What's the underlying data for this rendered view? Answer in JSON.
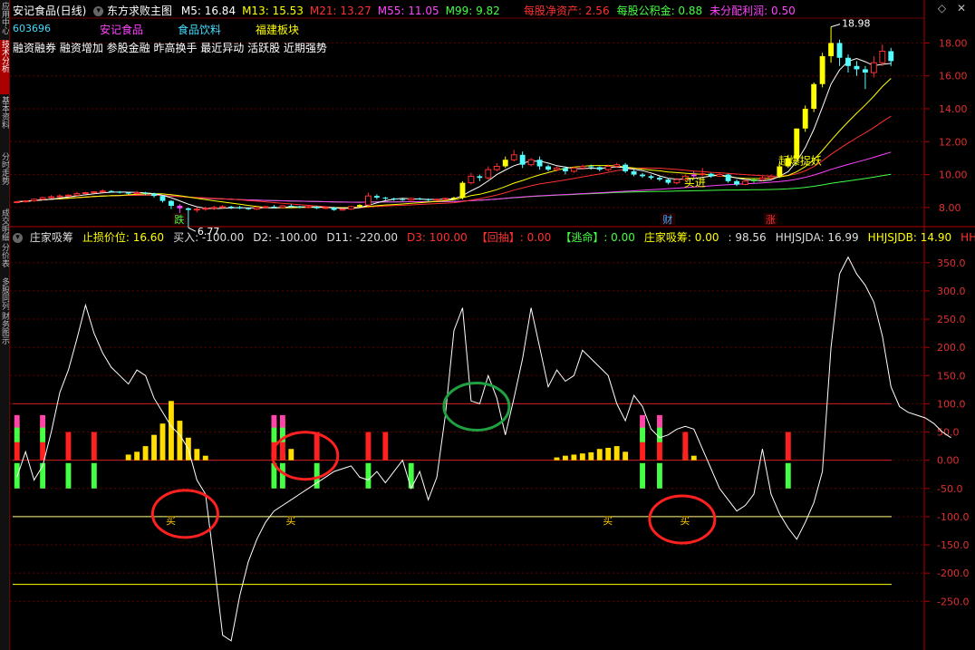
{
  "side_tabs": [
    "应用中心",
    "技术分析",
    "基本资料",
    "分时走势",
    "成交明细",
    "分价表",
    "多股同列",
    "财务图示"
  ],
  "header": {
    "stock_title": "安记食品(日线)",
    "template": "东方求败主图",
    "ma": [
      {
        "label": "M5: 16.84",
        "color": "#ffffff"
      },
      {
        "label": "M13: 15.53",
        "color": "#ffff00"
      },
      {
        "label": "M21: 13.27",
        "color": "#ff3030"
      },
      {
        "label": "M55: 11.05",
        "color": "#ff44ff"
      },
      {
        "label": "M99: 9.82",
        "color": "#44ff44"
      }
    ],
    "fundamentals": [
      {
        "label": "每股净资产: 2.56",
        "color": "#ff3030"
      },
      {
        "label": "每股公积金: 0.88",
        "color": "#44ff44"
      },
      {
        "label": "未分配利润: 0.50",
        "color": "#ff44ff"
      }
    ]
  },
  "concepts": "融资融券 融资增加 参股金融 昨高换手 最近异动 活跃股 近期强势",
  "stock_code": "603696",
  "badges": [
    {
      "text": "安记食品",
      "color": "#ff44ff"
    },
    {
      "text": "食品饮料",
      "color": "#44ddff"
    },
    {
      "text": "福建板块",
      "color": "#ffff00"
    }
  ],
  "indicator_header": [
    {
      "text": "庄家吸筹",
      "color": "#dddddd"
    },
    {
      "text": "止损价位: 16.60",
      "color": "#ffff00"
    },
    {
      "text": "买入: -100.00",
      "color": "#dddddd"
    },
    {
      "text": "D2: -100.00",
      "color": "#dddddd"
    },
    {
      "text": "D11: -220.00",
      "color": "#dddddd"
    },
    {
      "text": "D3: 100.00",
      "color": "#ff3030"
    },
    {
      "text": "【回抽】: 0.00",
      "color": "#ff3030"
    },
    {
      "text": "【逃命】: 0.00",
      "color": "#44ff44"
    },
    {
      "text": "庄家吸筹: 0.00",
      "color": "#ffff00"
    },
    {
      "text": ": 98.56",
      "color": "#dddddd"
    },
    {
      "text": "HHJSJDA: 16.99",
      "color": "#dddddd"
    },
    {
      "text": "HHJSJDB: 14.90",
      "color": "#ffff00"
    },
    {
      "text": "HHJS",
      "color": "#ff3030"
    }
  ],
  "chart_data": {
    "type": "candlestick",
    "price": {
      "ylim": [
        7.0,
        19.4
      ],
      "y_ticks": [
        "8.00",
        "10.00",
        "12.00",
        "14.00",
        "16.00",
        "18.00"
      ],
      "y_tick_values": [
        8,
        10,
        12,
        14,
        16,
        18
      ],
      "candles": [
        [
          8.3,
          8.35,
          8.4,
          8.25
        ],
        [
          8.35,
          8.4,
          8.45,
          8.3
        ],
        [
          8.4,
          8.5,
          8.55,
          8.35
        ],
        [
          8.5,
          8.6,
          8.65,
          8.45
        ],
        [
          8.6,
          8.65,
          8.75,
          8.55
        ],
        [
          8.65,
          8.7,
          8.8,
          8.6
        ],
        [
          8.7,
          8.75,
          8.8,
          8.65
        ],
        [
          8.75,
          8.85,
          8.95,
          8.7
        ],
        [
          8.85,
          8.9,
          8.95,
          8.8
        ],
        [
          8.9,
          8.95,
          9.0,
          8.85
        ],
        [
          8.95,
          9.0,
          9.1,
          8.9
        ],
        [
          9.0,
          8.95,
          9.05,
          8.9
        ],
        [
          8.95,
          8.9,
          9.0,
          8.85
        ],
        [
          8.9,
          8.85,
          8.95,
          8.8
        ],
        [
          8.85,
          8.9,
          9.0,
          8.8
        ],
        [
          8.9,
          8.85,
          8.95,
          8.75
        ],
        [
          8.85,
          8.7,
          8.9,
          8.6
        ],
        [
          8.7,
          8.4,
          8.75,
          8.3
        ],
        [
          8.4,
          8.1,
          8.45,
          7.9
        ],
        [
          8.1,
          7.95,
          8.2,
          7.6
        ],
        [
          7.95,
          7.85,
          8.0,
          6.77
        ],
        [
          7.85,
          7.9,
          8.0,
          7.7
        ],
        [
          7.9,
          7.95,
          8.05,
          7.8
        ],
        [
          7.95,
          8.0,
          8.1,
          7.85
        ],
        [
          8.0,
          8.05,
          8.15,
          7.95
        ],
        [
          8.05,
          8.0,
          8.1,
          7.9
        ],
        [
          8.0,
          7.95,
          8.1,
          7.9
        ],
        [
          7.95,
          7.9,
          8.0,
          7.85
        ],
        [
          7.9,
          8.0,
          8.05,
          7.85
        ],
        [
          8.0,
          8.05,
          8.1,
          7.95
        ],
        [
          8.05,
          8.0,
          8.15,
          7.95
        ],
        [
          8.0,
          8.1,
          8.15,
          7.95
        ],
        [
          8.1,
          8.05,
          8.2,
          8.0
        ],
        [
          8.05,
          8.0,
          8.1,
          7.95
        ],
        [
          8.0,
          8.05,
          8.1,
          7.95
        ],
        [
          8.05,
          7.95,
          8.1,
          7.9
        ],
        [
          7.95,
          8.0,
          8.05,
          7.9
        ],
        [
          8.0,
          7.85,
          8.05,
          7.8
        ],
        [
          7.85,
          7.9,
          7.95,
          7.8
        ],
        [
          7.9,
          8.05,
          8.1,
          7.85
        ],
        [
          8.05,
          8.15,
          8.2,
          8.0
        ],
        [
          8.15,
          8.7,
          8.9,
          8.1
        ],
        [
          8.7,
          8.6,
          8.8,
          8.5
        ],
        [
          8.6,
          8.55,
          8.65,
          8.45
        ],
        [
          8.55,
          8.5,
          8.6,
          8.4
        ],
        [
          8.5,
          8.45,
          8.55,
          8.4
        ],
        [
          8.45,
          8.55,
          8.6,
          8.4
        ],
        [
          8.55,
          8.5,
          8.6,
          8.45
        ],
        [
          8.5,
          8.45,
          8.55,
          8.4
        ],
        [
          8.45,
          8.5,
          8.55,
          8.4
        ],
        [
          8.5,
          8.55,
          8.6,
          8.45
        ],
        [
          8.55,
          8.6,
          8.65,
          8.5
        ],
        [
          8.6,
          9.5,
          9.6,
          8.5
        ],
        [
          9.5,
          9.9,
          10.1,
          9.4
        ],
        [
          9.9,
          9.8,
          10.0,
          9.6
        ],
        [
          9.8,
          10.3,
          10.5,
          9.7
        ],
        [
          10.3,
          10.5,
          10.7,
          10.2
        ],
        [
          10.5,
          10.9,
          11.1,
          10.4
        ],
        [
          10.9,
          11.2,
          11.5,
          10.8
        ],
        [
          11.2,
          10.6,
          11.4,
          10.4
        ],
        [
          10.6,
          10.9,
          11.0,
          10.5
        ],
        [
          10.9,
          10.5,
          11.1,
          10.3
        ],
        [
          10.5,
          10.3,
          10.6,
          10.2
        ],
        [
          10.3,
          10.4,
          10.5,
          10.2
        ],
        [
          10.4,
          10.2,
          10.5,
          10.0
        ],
        [
          10.2,
          10.4,
          10.5,
          10.1
        ],
        [
          10.4,
          10.5,
          10.6,
          10.3
        ],
        [
          10.5,
          10.45,
          10.6,
          10.3
        ],
        [
          10.45,
          10.3,
          10.5,
          10.2
        ],
        [
          10.3,
          10.5,
          10.6,
          10.2
        ],
        [
          10.5,
          10.6,
          10.7,
          10.4
        ],
        [
          10.6,
          10.2,
          10.7,
          10.1
        ],
        [
          10.2,
          10.0,
          10.3,
          9.9
        ],
        [
          10.0,
          9.9,
          10.1,
          9.8
        ],
        [
          9.9,
          9.8,
          10.0,
          9.7
        ],
        [
          9.8,
          9.7,
          9.9,
          9.6
        ],
        [
          9.7,
          9.5,
          9.8,
          9.4
        ],
        [
          9.5,
          9.7,
          9.8,
          9.4
        ],
        [
          9.7,
          9.9,
          10.0,
          9.6
        ],
        [
          9.9,
          10.0,
          10.2,
          9.8
        ],
        [
          10.0,
          10.05,
          10.4,
          9.9
        ],
        [
          10.05,
          9.9,
          10.1,
          9.8
        ],
        [
          9.9,
          10.0,
          10.1,
          9.85
        ],
        [
          10.0,
          9.6,
          10.05,
          9.5
        ],
        [
          9.6,
          9.4,
          9.7,
          9.3
        ],
        [
          9.4,
          9.6,
          9.7,
          9.35
        ],
        [
          9.6,
          9.7,
          9.8,
          9.5
        ],
        [
          9.7,
          9.8,
          9.9,
          9.6
        ],
        [
          9.8,
          9.9,
          10.0,
          9.7
        ],
        [
          9.9,
          10.5,
          10.6,
          9.8
        ],
        [
          10.5,
          11.0,
          11.2,
          10.4
        ],
        [
          11.0,
          12.8,
          12.8,
          10.9
        ],
        [
          12.8,
          14.0,
          14.2,
          12.6
        ],
        [
          14.0,
          15.5,
          15.6,
          13.8
        ],
        [
          15.5,
          17.2,
          17.4,
          15.3
        ],
        [
          17.2,
          18.0,
          18.98,
          16.8
        ],
        [
          18.0,
          17.1,
          18.2,
          16.6
        ],
        [
          17.1,
          16.6,
          17.3,
          16.2
        ],
        [
          16.6,
          16.4,
          16.9,
          16.0
        ],
        [
          16.4,
          16.2,
          16.6,
          15.2
        ],
        [
          16.2,
          16.8,
          17.2,
          15.9
        ],
        [
          16.8,
          17.5,
          17.9,
          16.6
        ],
        [
          17.5,
          16.9,
          17.7,
          16.6
        ]
      ],
      "color_override": {
        "19": "#ff44ff",
        "40": "#ffff00",
        "51": "#ffff00",
        "52": "#ffff00",
        "57": "#ffff00",
        "89": "#ffff00",
        "90": "#ffff00",
        "91": "#ffff00",
        "92": "#ffff00",
        "93": "#ffff00",
        "94": "#ffff00",
        "95": "#ffff00",
        "79": "#ff44ff",
        "86": "#44ff44"
      },
      "annotations": [
        {
          "text": "18.98",
          "idx": 95,
          "price": 18.98,
          "color": "#ffffff"
        },
        {
          "text": "6.77",
          "idx": 20,
          "price": 6.77,
          "color": "#ffffff"
        },
        {
          "text": "起爆捉妖",
          "idx": 88,
          "price": 10.6,
          "color": "#ffff00"
        },
        {
          "text": "买进",
          "idx": 77,
          "price": 9.3,
          "color": "#ffff00"
        }
      ],
      "bottom_tags": [
        {
          "text": "跌",
          "idx": 19,
          "color": "#44ff44"
        },
        {
          "text": "财",
          "idx": 76,
          "color": "#44aaff"
        },
        {
          "text": "涨",
          "idx": 88,
          "color": "#ff3030"
        }
      ]
    },
    "indicator": {
      "ylim": [
        -325,
        385
      ],
      "y_ticks": [
        "350.0",
        "300.0",
        "250.0",
        "200.0",
        "150.0",
        "100.0",
        "50.0",
        "0.00",
        "-50.0",
        "-100.0",
        "-150.0",
        "-200.0",
        "-250.0"
      ],
      "y_tick_values": [
        350,
        300,
        250,
        200,
        150,
        100,
        50,
        0,
        -50,
        -100,
        -150,
        -200,
        -250
      ],
      "hlines": [
        {
          "y": 100,
          "color": "#cc2020"
        },
        {
          "y": 0,
          "color": "#cc2020"
        },
        {
          "y": -100,
          "color": "#ffff80"
        },
        {
          "y": -220,
          "color": "#ffff00"
        }
      ],
      "line": [
        -30,
        15,
        -35,
        -10,
        50,
        120,
        160,
        215,
        275,
        225,
        190,
        165,
        150,
        135,
        160,
        150,
        110,
        85,
        60,
        45,
        20,
        -35,
        -60,
        -180,
        -310,
        -320,
        -240,
        -180,
        -140,
        -110,
        -90,
        -80,
        -70,
        -60,
        -50,
        -40,
        -30,
        -20,
        -15,
        -10,
        -30,
        -35,
        -20,
        -40,
        -20,
        0,
        -50,
        -20,
        -70,
        -30,
        80,
        230,
        270,
        105,
        100,
        150,
        110,
        45,
        110,
        180,
        270,
        200,
        130,
        160,
        140,
        150,
        195,
        180,
        165,
        150,
        100,
        70,
        115,
        95,
        55,
        40,
        45,
        55,
        60,
        55,
        20,
        -15,
        -50,
        -70,
        -90,
        -80,
        -60,
        20,
        -60,
        -95,
        -120,
        -140,
        -110,
        -75,
        -20,
        200,
        330,
        360,
        330,
        310,
        280,
        220,
        130,
        95,
        85,
        80,
        75,
        65,
        50,
        40
      ],
      "events": [
        {
          "idx": 0,
          "type": "full"
        },
        {
          "idx": 3,
          "type": "full"
        },
        {
          "idx": 6,
          "type": "redgreen"
        },
        {
          "idx": 9,
          "type": "redgreen"
        },
        {
          "idx": 30,
          "type": "full"
        },
        {
          "idx": 31,
          "type": "full"
        },
        {
          "idx": 35,
          "type": "redgreen"
        },
        {
          "idx": 41,
          "type": "redgreen"
        },
        {
          "idx": 43,
          "type": "red"
        },
        {
          "idx": 46,
          "type": "green"
        },
        {
          "idx": 73,
          "type": "full"
        },
        {
          "idx": 75,
          "type": "full"
        },
        {
          "idx": 78,
          "type": "red"
        },
        {
          "idx": 90,
          "type": "redgreen"
        }
      ],
      "yellow_bars": [
        {
          "idx": 13,
          "v": 10
        },
        {
          "idx": 14,
          "v": 15
        },
        {
          "idx": 15,
          "v": 25
        },
        {
          "idx": 16,
          "v": 45
        },
        {
          "idx": 17,
          "v": 65
        },
        {
          "idx": 18,
          "v": 105
        },
        {
          "idx": 19,
          "v": 70
        },
        {
          "idx": 20,
          "v": 40
        },
        {
          "idx": 21,
          "v": 20
        },
        {
          "idx": 22,
          "v": 8
        },
        {
          "idx": 31,
          "v": 12
        },
        {
          "idx": 32,
          "v": 20
        },
        {
          "idx": 63,
          "v": 5
        },
        {
          "idx": 64,
          "v": 8
        },
        {
          "idx": 65,
          "v": 10
        },
        {
          "idx": 66,
          "v": 12
        },
        {
          "idx": 67,
          "v": 14
        },
        {
          "idx": 68,
          "v": 20
        },
        {
          "idx": 69,
          "v": 22
        },
        {
          "idx": 70,
          "v": 25
        },
        {
          "idx": 71,
          "v": 15
        },
        {
          "idx": 78,
          "v": 12
        },
        {
          "idx": 79,
          "v": 8
        }
      ],
      "buy_labels": [
        {
          "text": "买",
          "idx": 18
        },
        {
          "text": "买",
          "idx": 32
        },
        {
          "text": "买",
          "idx": 69
        },
        {
          "text": "买",
          "idx": 78
        }
      ],
      "circles": [
        {
          "idx": 19,
          "y": -95,
          "color": "#ff2020"
        },
        {
          "idx": 33,
          "y": 8,
          "color": "#ff2020"
        },
        {
          "idx": 53,
          "y": 95,
          "color": "#20a040"
        },
        {
          "idx": 77,
          "y": -105,
          "color": "#ff2020"
        }
      ]
    }
  }
}
